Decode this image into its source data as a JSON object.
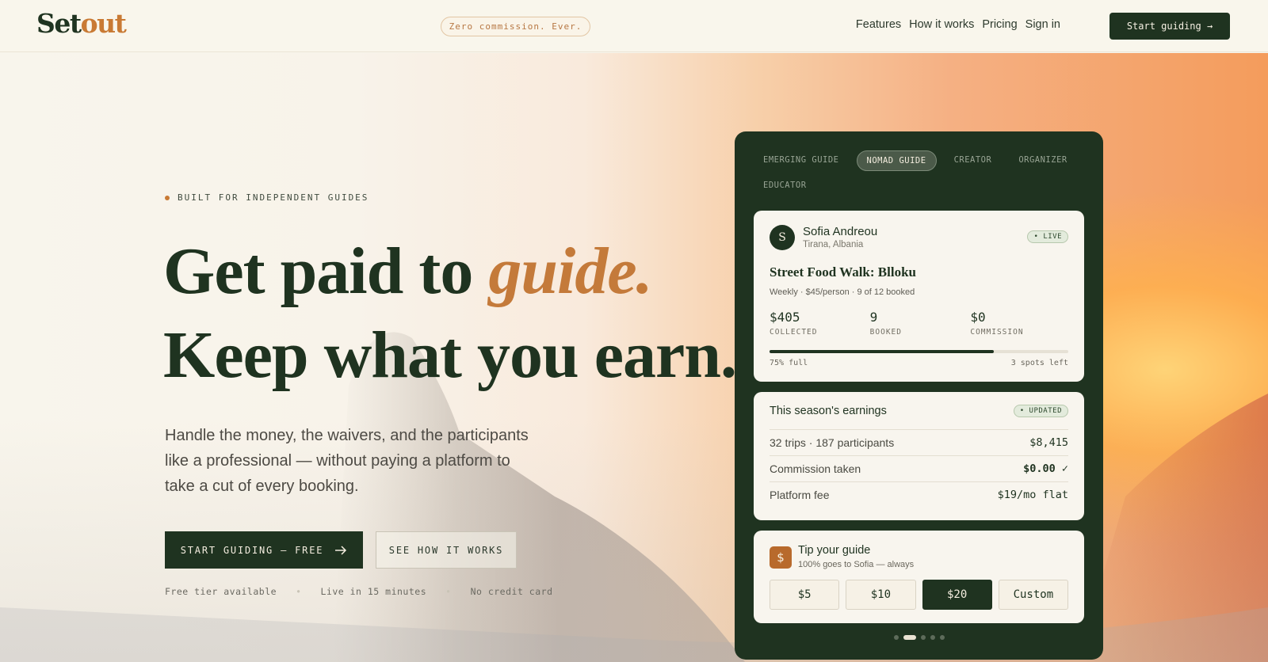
{
  "header": {
    "logo_main": "Set",
    "logo_accent": "out",
    "tagline": "Zero commission. Ever.",
    "nav": [
      "Features",
      "How it works",
      "Pricing",
      "Sign in"
    ],
    "cta": "Start guiding →"
  },
  "hero": {
    "eyebrow": "BUILT FOR INDEPENDENT GUIDES",
    "headline_line1": "Get paid to ",
    "headline_accent": "guide.",
    "headline_line2": "Keep what you earn.",
    "subtext": "Handle the money, the waivers, and the participants like a professional — without paying a platform to take a cut of every booking.",
    "primary_button": "START GUIDING — FREE",
    "secondary_button": "SEE HOW IT WORKS",
    "perks": [
      "Free tier available",
      "Live in 15 minutes",
      "No credit card"
    ]
  },
  "panel": {
    "tabs": [
      "EMERGING GUIDE",
      "NOMAD GUIDE",
      "CREATOR",
      "ORGANIZER",
      "EDUCATOR"
    ],
    "active_tab_index": 1,
    "trip_card": {
      "avatar_initial": "S",
      "guide_name": "Sofia Andreou",
      "location": "Tirana, Albania",
      "status": "• LIVE",
      "trip_title": "Street Food Walk: Blloku",
      "trip_meta": "Weekly · $45/person · 9 of 12 booked",
      "stats": [
        {
          "value": "$405",
          "label": "COLLECTED"
        },
        {
          "value": "9",
          "label": "BOOKED"
        },
        {
          "value": "$0",
          "label": "COMMISSION"
        }
      ],
      "fill_fraction": 0.75,
      "fill_label": "75% full",
      "spots_label": "3 spots left"
    },
    "earnings_card": {
      "title": "This season's earnings",
      "badge": "• UPDATED",
      "rows": [
        {
          "label": "32 trips · 187 participants",
          "value": "$8,415"
        },
        {
          "label": "Commission taken",
          "value": "$0.00 ✓"
        },
        {
          "label": "Platform fee",
          "value": "$19/mo flat"
        }
      ]
    },
    "tip_card": {
      "icon_glyph": "$",
      "title": "Tip your guide",
      "subtitle": "100% goes to Sofia — always",
      "options": [
        "$5",
        "$10",
        "$20",
        "Custom"
      ],
      "selected_index": 2
    },
    "carousel": {
      "count": 5,
      "active_index": 1
    }
  },
  "colors": {
    "brand_dark": "#1f3320",
    "accent": "#c97a34",
    "cream": "#f8f5ec"
  }
}
